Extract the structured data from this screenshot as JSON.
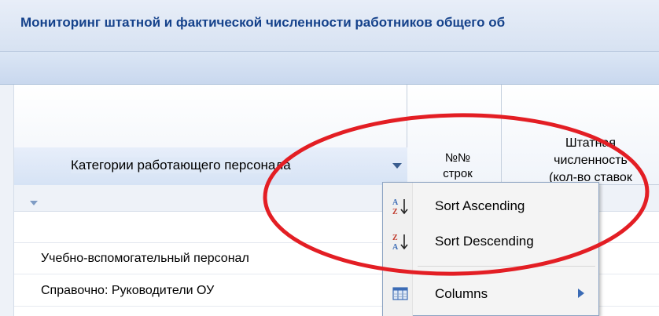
{
  "title": "Мониторинг штатной и фактической численности работников общего об",
  "grid": {
    "headers": {
      "category": "Категории работающего персонала",
      "row_number_line1": "№№",
      "row_number_line2": "строк",
      "staff_line1": "Штатная",
      "staff_line2": "численность",
      "staff_line3": "(кол-во ставок"
    },
    "rows": [
      {
        "label": "Учебно-вспомогательный персонал"
      },
      {
        "label": "Справочно: Руководители ОУ"
      }
    ]
  },
  "context_menu": {
    "items": [
      {
        "label": "Sort Ascending",
        "icon": "sort-ascending-icon"
      },
      {
        "label": "Sort Descending",
        "icon": "sort-descending-icon"
      },
      {
        "label": "Columns",
        "icon": "columns-icon",
        "has_submenu": true
      }
    ]
  },
  "colors": {
    "title_text": "#15428b",
    "annotation": "#e31e24",
    "submenu_arrow": "#3b6bb5"
  }
}
